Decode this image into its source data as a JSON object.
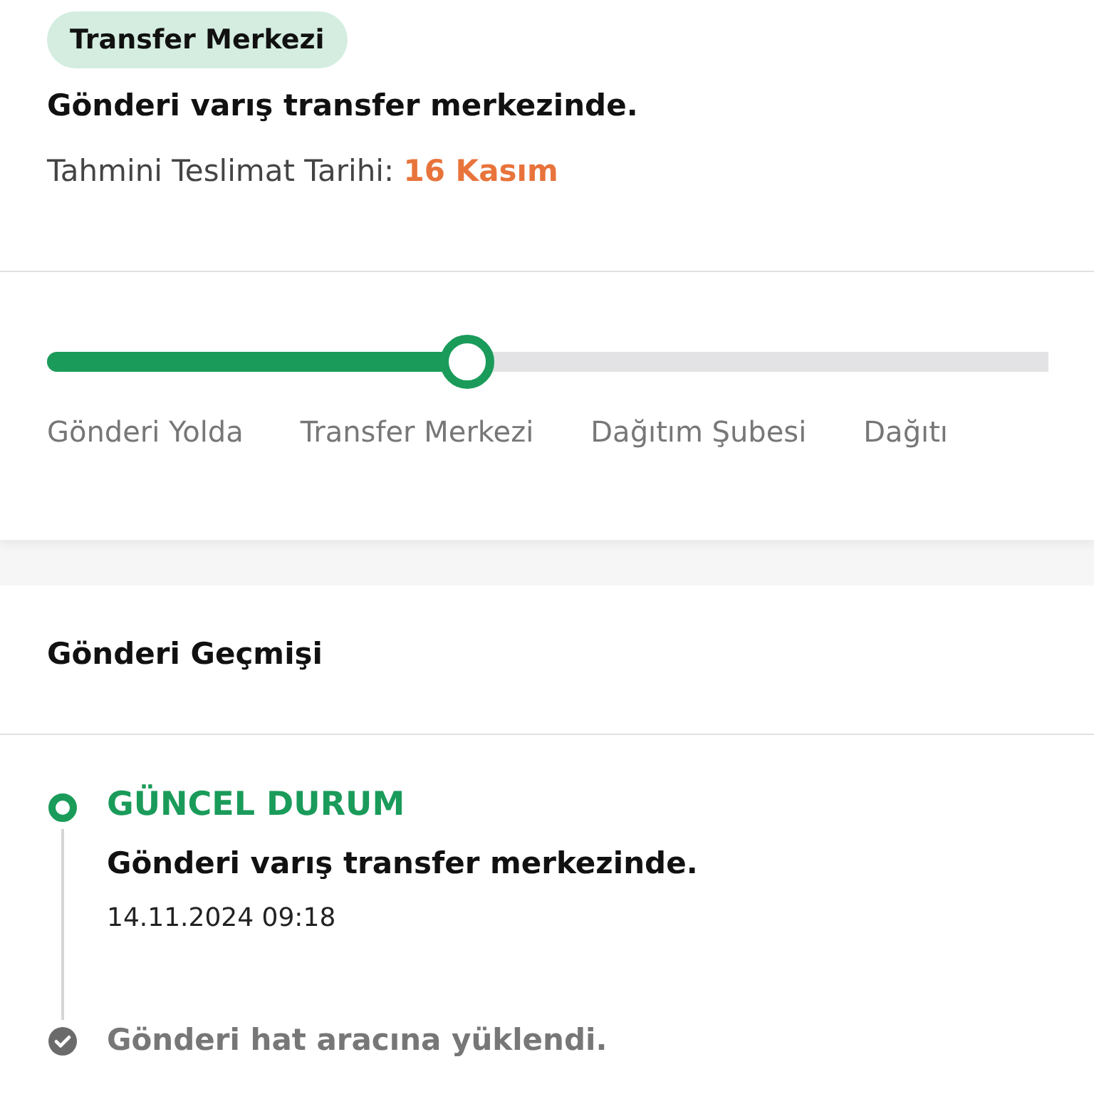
{
  "status_badge": "Transfer Merkezi",
  "headline": "Gönderi varış transfer merkezinde.",
  "estimate": {
    "label": "Tahmini Teslimat Tarihi:",
    "value": "16 Kasım"
  },
  "progress": {
    "level": 0.42,
    "steps": [
      "Gönderi Yolda",
      "Transfer Merkezi",
      "Dağıtım Şubesi",
      "Dağıtı"
    ]
  },
  "history": {
    "title": "Gönderi Geçmişi",
    "events": [
      {
        "kind": "current",
        "label": "GÜNCEL DURUM",
        "text": "Gönderi varış transfer merkezinde.",
        "time": "14.11.2024 09:18"
      },
      {
        "kind": "past",
        "text": "Gönderi hat aracına yüklendi."
      }
    ]
  }
}
